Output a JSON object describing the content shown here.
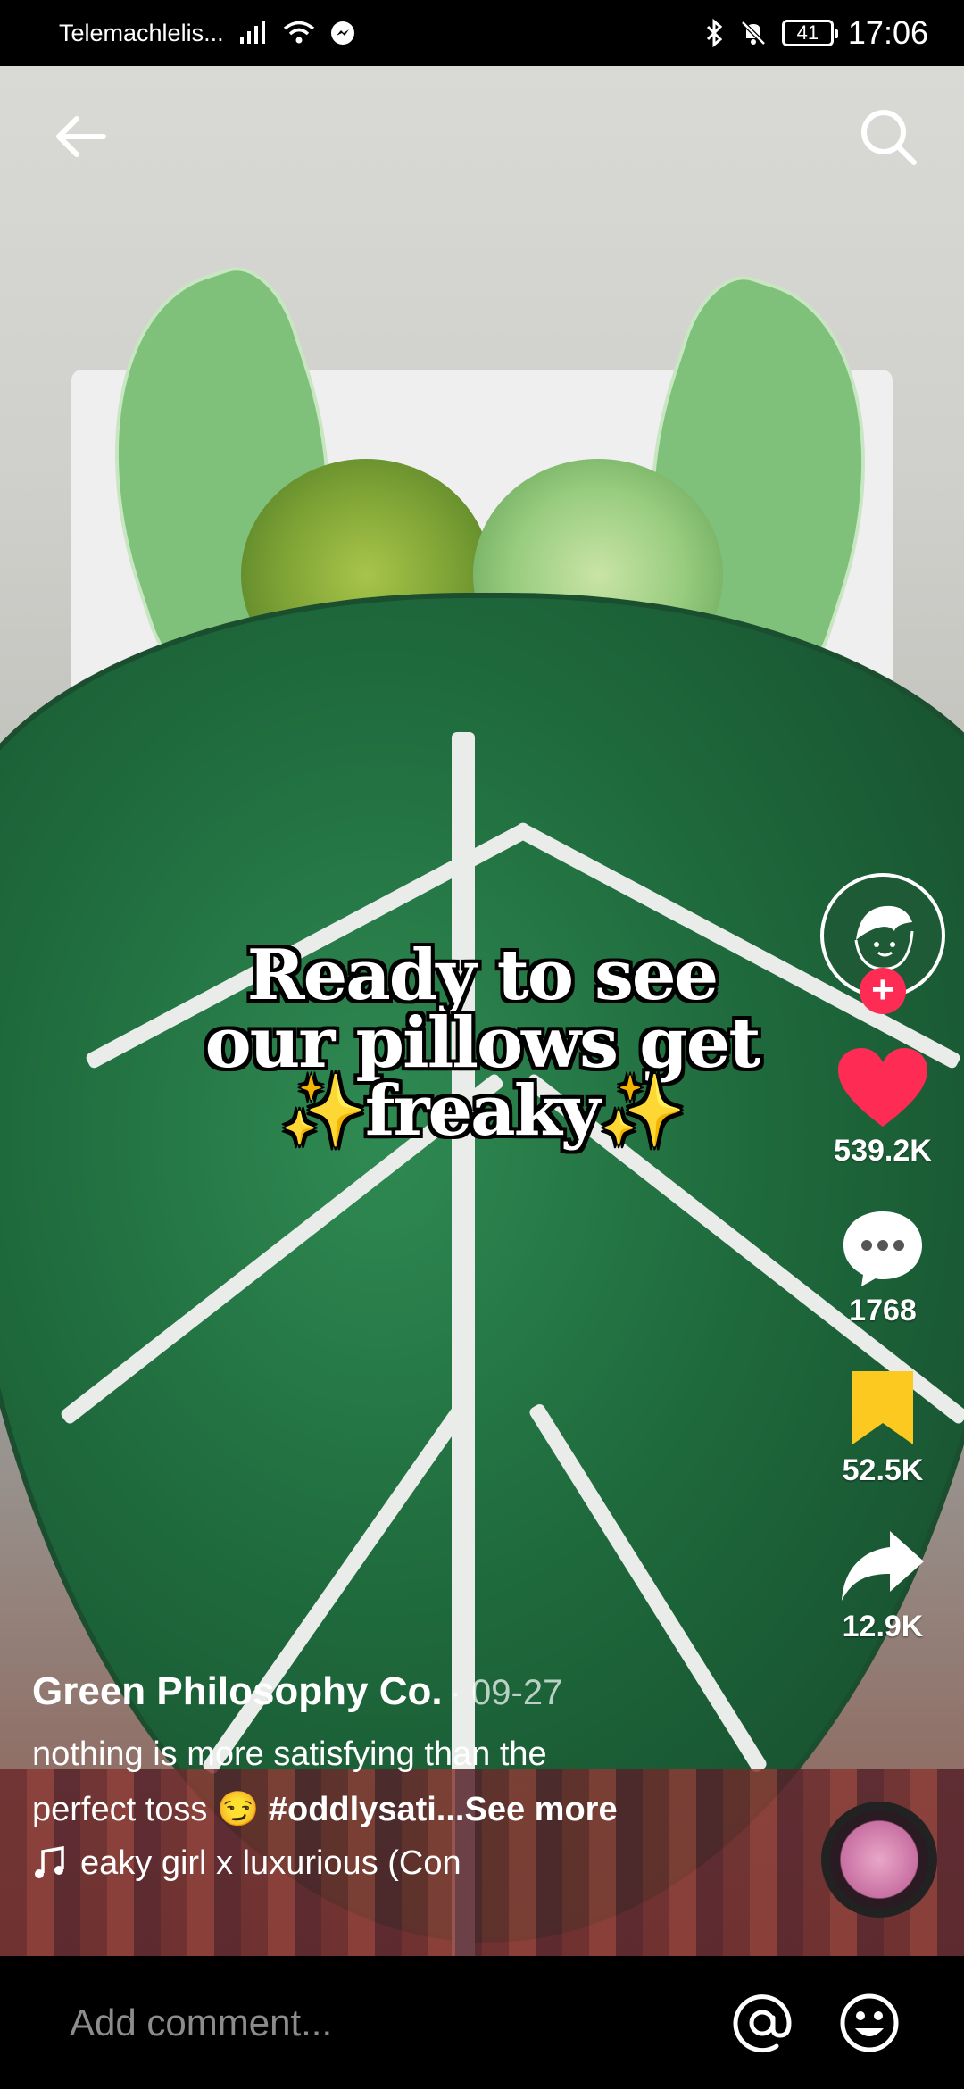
{
  "status_bar": {
    "carrier": "Telemachlelis...",
    "battery": "41",
    "time": "17:06"
  },
  "video": {
    "overlay_lines": [
      "Ready to see",
      "our pillows get",
      "✨freaky✨"
    ]
  },
  "rail": {
    "likes": "539.2K",
    "comments": "1768",
    "bookmarks": "52.5K",
    "shares": "12.9K"
  },
  "post": {
    "author": "Green Philosophy Co.",
    "date": "· 09-27",
    "desc_line1": "nothing is more satisfying than the",
    "desc_line2_text": "perfect toss 😏 ",
    "hashtag": "#oddlysati...",
    "see_more": "See more",
    "music": "eaky girl x luxurious (Con"
  },
  "comment_bar": {
    "placeholder": "Add comment..."
  },
  "colors": {
    "like": "#fe2c55",
    "bookmark": "#fbc91f",
    "brand_green": "#1e5a36"
  }
}
